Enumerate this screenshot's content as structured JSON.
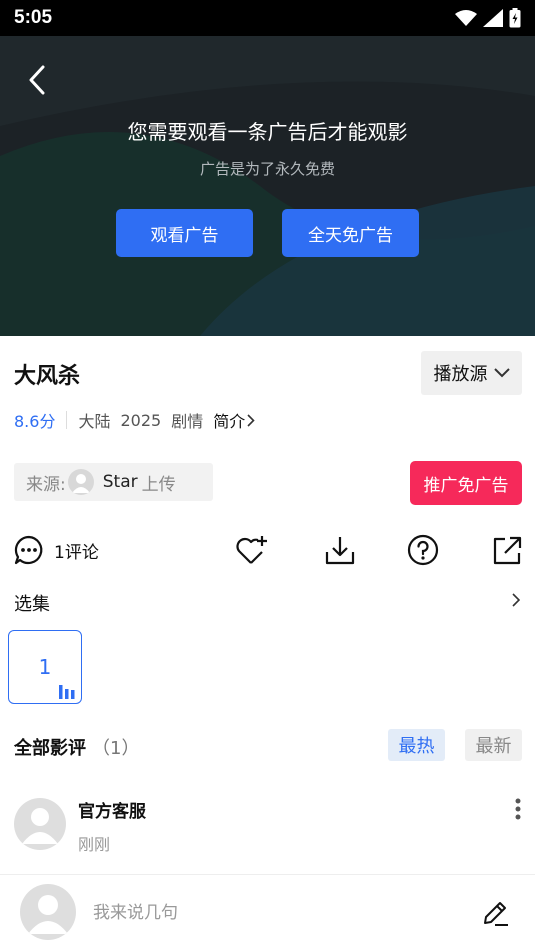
{
  "status_bar": {
    "time": "5:05"
  },
  "player": {
    "ad_message": "您需要观看一条广告后才能观影",
    "ad_subtext": "广告是为了永久免费",
    "watch_ad_label": "观看广告",
    "ad_free_label": "全天免广告"
  },
  "movie": {
    "title": "大风杀",
    "source_label": "播放源",
    "score": "8.6分",
    "region": "大陆",
    "year": "2025",
    "genre": "剧情",
    "intro_label": "简介"
  },
  "uploader": {
    "prefix": "来源:",
    "name": "Star",
    "suffix": "上传"
  },
  "promo_label": "推广免广告",
  "actions": {
    "comments": "1评论"
  },
  "episodes": {
    "title": "选集",
    "items": [
      "1"
    ]
  },
  "reviews": {
    "title": "全部影评",
    "count": "（1）",
    "sort_hot": "最热",
    "sort_new": "最新",
    "items": [
      {
        "author": "官方客服",
        "time": "刚刚"
      }
    ]
  },
  "composer": {
    "placeholder": "我来说几句"
  },
  "colors": {
    "accent": "#2f6ef3",
    "promo": "#f6295a"
  },
  "icons": [
    "wifi-icon",
    "signal-icon",
    "battery-icon",
    "back-arrow-icon",
    "chevron-down-icon",
    "chevron-right-icon",
    "avatar-icon",
    "comment-icon",
    "favorite-add-icon",
    "download-icon",
    "help-icon",
    "share-icon",
    "playing-bars-icon",
    "more-vertical-icon",
    "edit-icon"
  ]
}
